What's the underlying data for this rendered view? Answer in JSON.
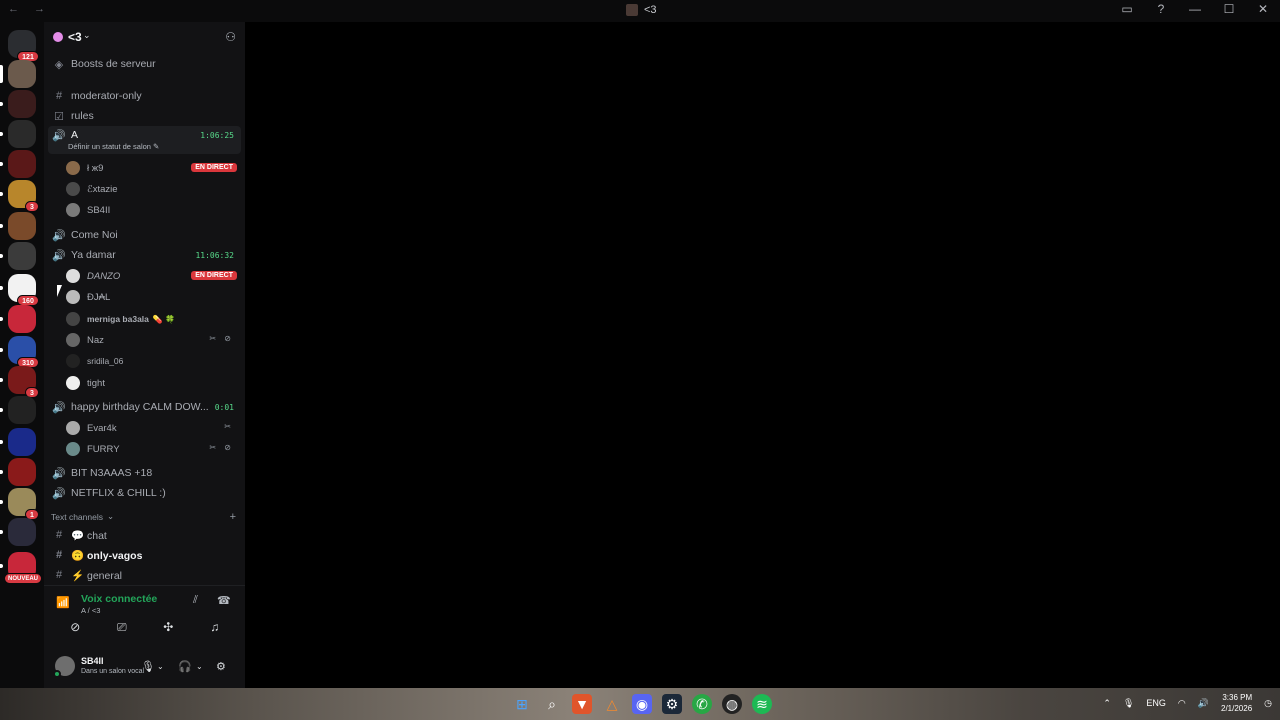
{
  "window": {
    "title": "<3",
    "nav_arrows": "← →",
    "controls": [
      "inbox-icon",
      "help-icon",
      "minimize-icon",
      "maximize-icon",
      "close-icon"
    ]
  },
  "guilds": [
    {
      "badge": "121"
    },
    {
      "badge": ""
    },
    {
      "badge": ""
    },
    {
      "badge": ""
    },
    {
      "badge": ""
    },
    {
      "badge": "3"
    },
    {
      "badge": ""
    },
    {
      "badge": ""
    },
    {
      "badge": "160"
    },
    {
      "badge": ""
    },
    {
      "badge": "310"
    },
    {
      "badge": "3"
    },
    {
      "badge": ""
    },
    {
      "badge": ""
    },
    {
      "badge": ""
    },
    {
      "badge": "1"
    },
    {
      "badge": ""
    },
    {
      "badge": "NOUVEAU"
    }
  ],
  "server": {
    "name": "<3",
    "boost_label": "Boosts de serveur"
  },
  "channels": {
    "moderator": "moderator-only",
    "rules": "rules",
    "voice_a": {
      "name": "A",
      "time": "1:06:25",
      "status": "Définir un statut de salon ✎"
    },
    "a_members": [
      {
        "name": "ł ж9",
        "live": "EN DIRECT"
      },
      {
        "name": "ℰxtazie"
      },
      {
        "name": "SB4II"
      }
    ],
    "come_noi": "Come Noi",
    "ya_damar": {
      "name": "Ya damar",
      "time": "11:06:32"
    },
    "yd_members": [
      {
        "name": "DANZO",
        "live": "EN DIRECT"
      },
      {
        "name": "ÐJ₳L"
      },
      {
        "name": "merniga ba3ala",
        "emoji": "💊 🍀"
      },
      {
        "name": "Naz",
        "mutes": "✂ ⊘"
      },
      {
        "name": "sridila_06"
      },
      {
        "name": "tight"
      }
    ],
    "birthday": {
      "name": "happy birthday CALM DOW...",
      "time": "0:01"
    },
    "bd_members": [
      {
        "name": "Evar4k",
        "mutes": "✂"
      },
      {
        "name": "FURRY",
        "mutes": "✂ ⊘"
      }
    ],
    "bit": "BIT N3AAAS +18",
    "netflix": "NETFLIX & CHILL :)",
    "text_category": "Text channels",
    "chat": "💬 chat",
    "vagos": "🙃 only-vagos",
    "general": "⚡ general"
  },
  "voice_panel": {
    "title": "Voix connectée",
    "subtitle": "A / <3"
  },
  "user": {
    "name": "SB4II",
    "status": "Dans un salon vocal"
  },
  "taskbar": {
    "lang": "ENG",
    "time": "3:36 PM",
    "date": "2/1/2026"
  }
}
